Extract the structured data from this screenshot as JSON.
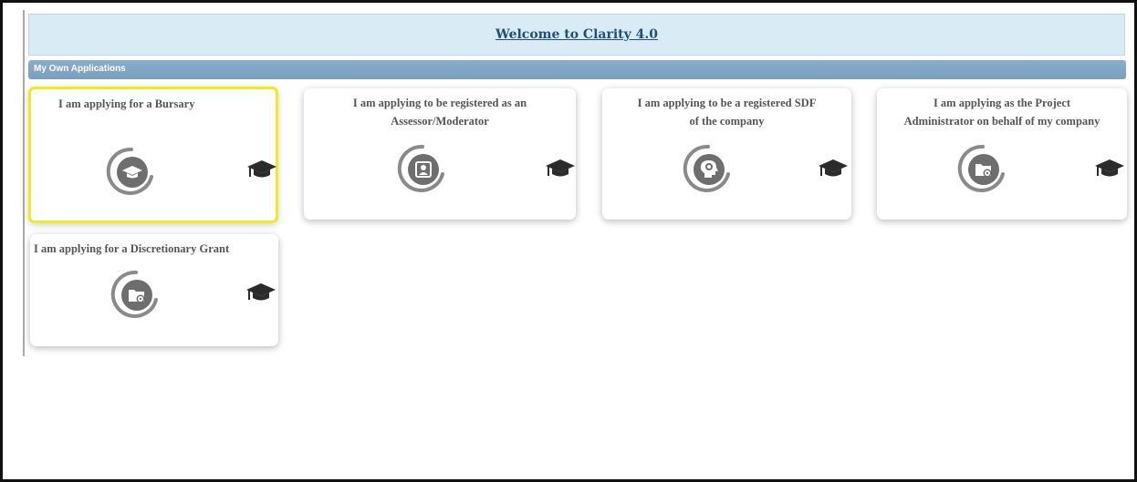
{
  "header": {
    "welcome_text": "Welcome to Clarity 4.0"
  },
  "section": {
    "title": "My Own Applications"
  },
  "cards": [
    {
      "title": "I am applying for a Bursary",
      "icon": "graduation-cap-icon",
      "selected": true
    },
    {
      "title": "I am applying to be registered as an\nAssessor/Moderator",
      "icon": "id-card-icon",
      "selected": false
    },
    {
      "title": "I am applying to be a registered SDF\nof the company",
      "icon": "head-brain-icon",
      "selected": false
    },
    {
      "title": "I am applying as the Project\nAdministrator on behalf of my company",
      "icon": "folder-gear-icon",
      "selected": false
    },
    {
      "title": "I am applying for a Discretionary Grant",
      "icon": "folder-gear-icon",
      "selected": false
    }
  ],
  "colors": {
    "header_bg": "#d9ecf5",
    "header_text": "#1f4f78",
    "section_bar": "#7fa6c3",
    "selected_border": "#f2ea1c",
    "icon_gray": "#6b6b6b"
  }
}
